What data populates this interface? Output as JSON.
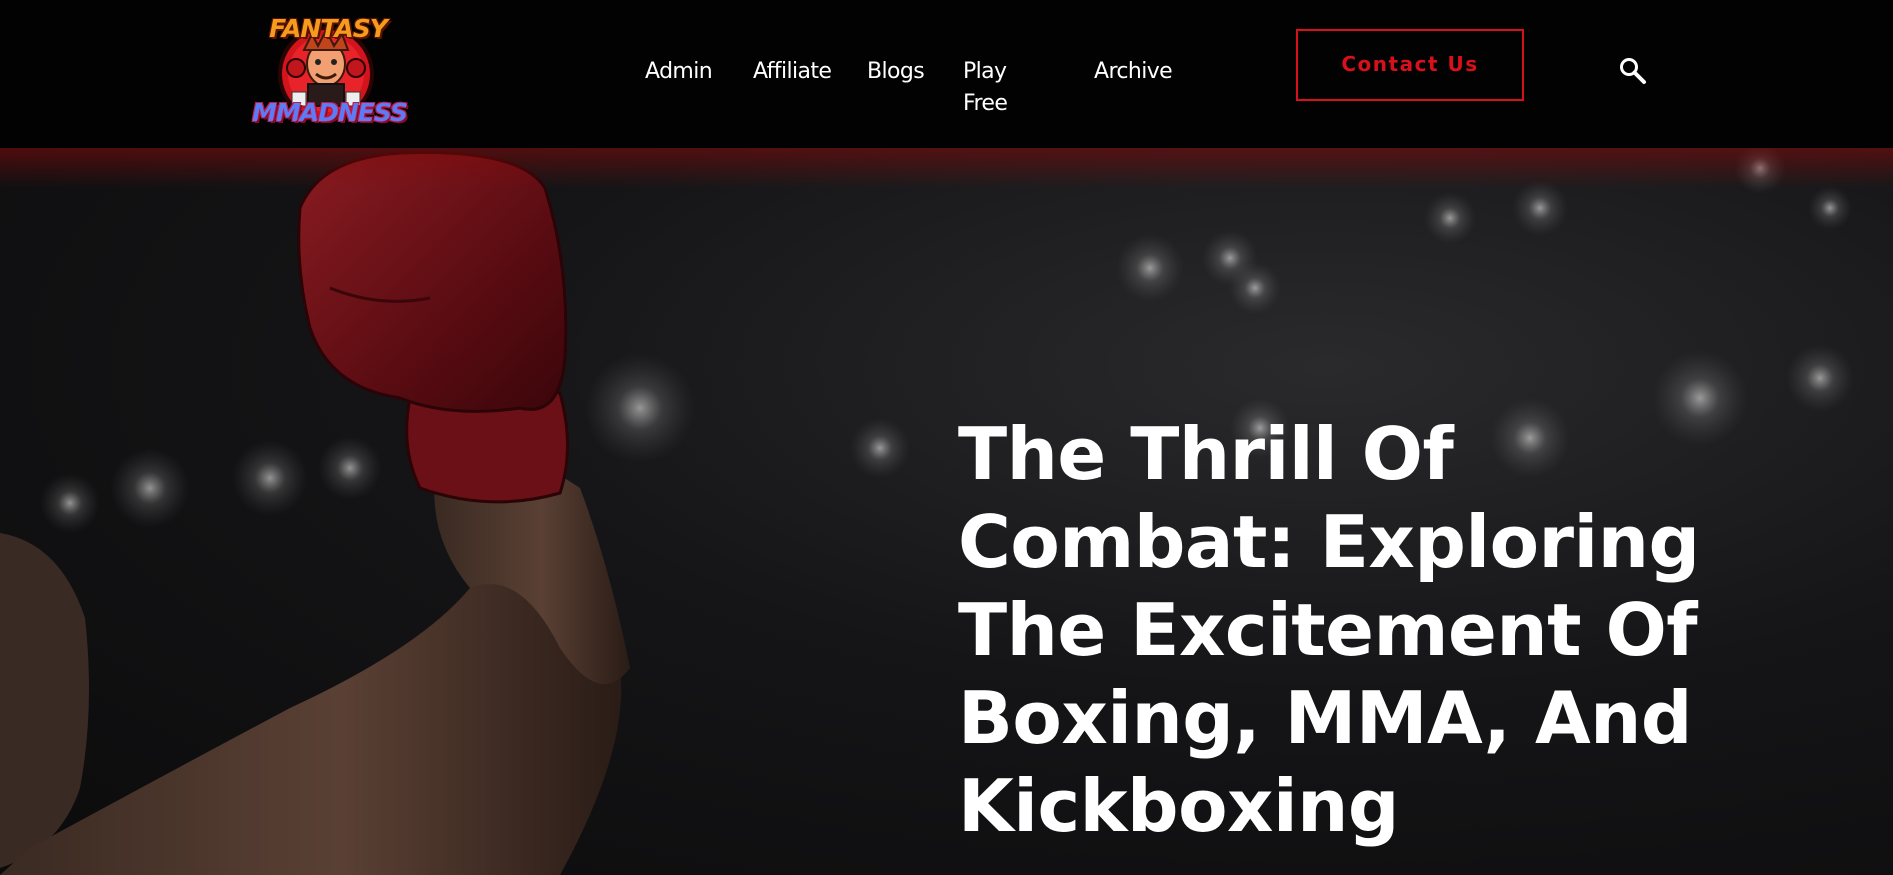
{
  "brand": {
    "logo_top_word": "FANTASY",
    "logo_bottom_word": "MMADNESS",
    "logo_icon": "fighter-mascot-icon"
  },
  "nav": {
    "items": [
      {
        "label": "Admin"
      },
      {
        "label": "Affiliate"
      },
      {
        "label": "Blogs"
      },
      {
        "label": "Play Free"
      },
      {
        "label": "Archive"
      }
    ]
  },
  "header": {
    "contact_label": "Contact Us",
    "search_icon": "search-icon"
  },
  "hero": {
    "title": "The Thrill Of Combat: Exploring The Excitement Of Boxing, MMA, And Kickboxing",
    "image_subject": "raised-boxing-glove-arm"
  },
  "colors": {
    "accent": "#d7101a",
    "header_bg": "#020202",
    "text": "#ffffff"
  }
}
